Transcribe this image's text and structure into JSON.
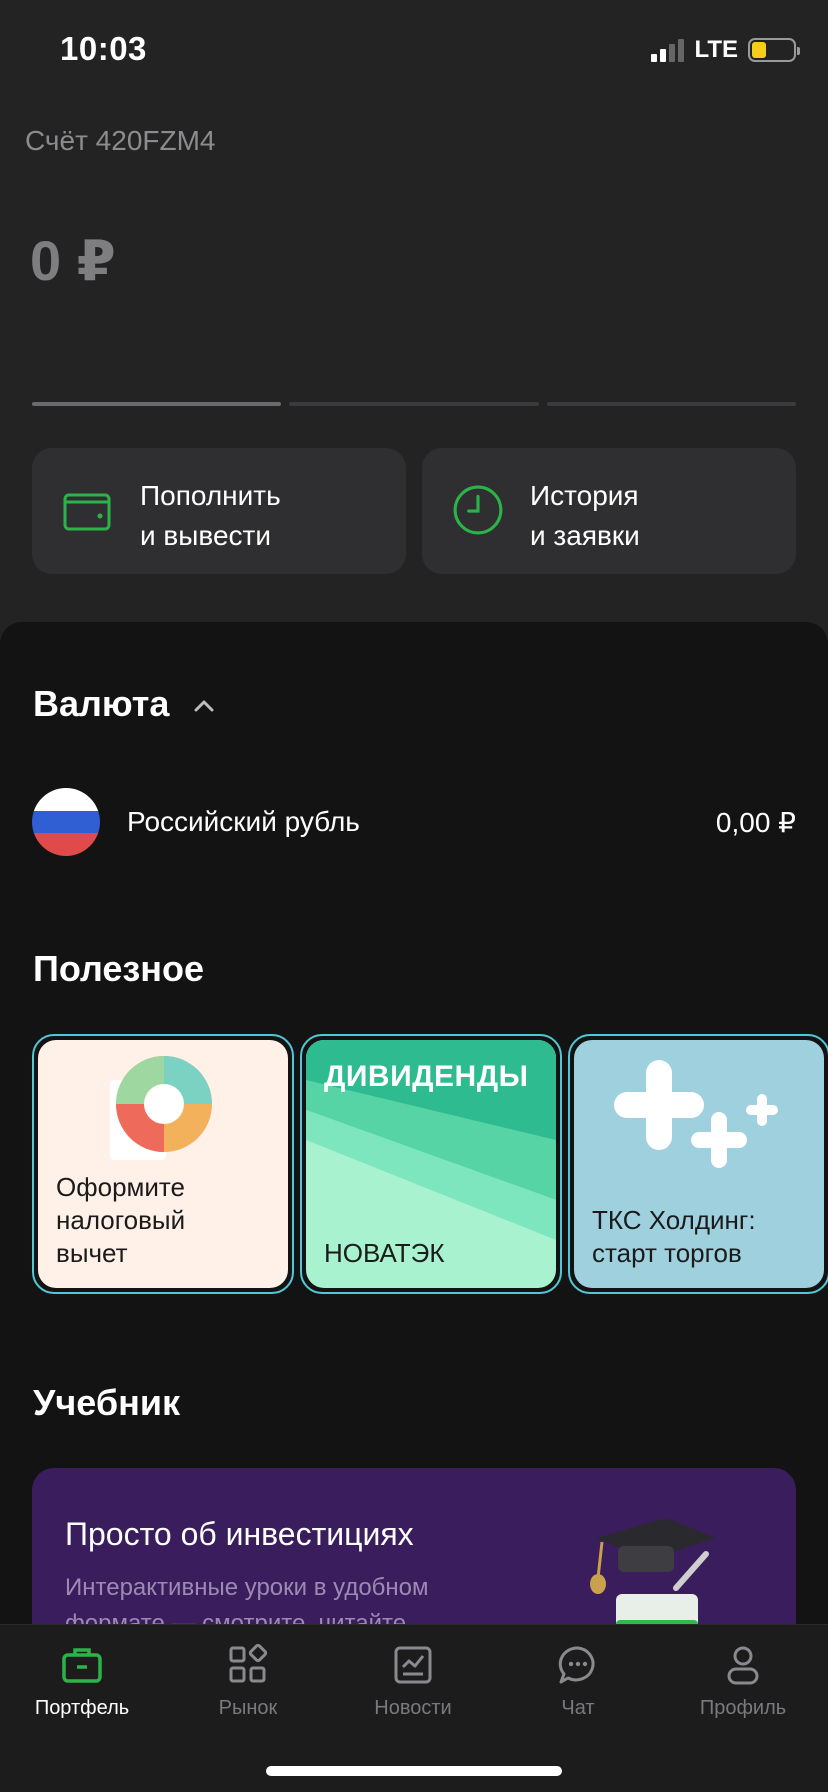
{
  "status": {
    "time": "10:03",
    "network": "LTE"
  },
  "account": {
    "label": "Счёт 420FZM4",
    "balance": "0 ₽"
  },
  "actions": [
    {
      "line1": "Пополнить",
      "line2": "и вывести",
      "icon": "wallet-icon"
    },
    {
      "line1": "История",
      "line2": "и заявки",
      "icon": "clock-icon"
    }
  ],
  "currency": {
    "title": "Валюта",
    "items": [
      {
        "name": "Российский рубль",
        "amount": "0,00 ₽",
        "icon": "russia-flag-icon"
      }
    ]
  },
  "useful": {
    "title": "Полезное",
    "cards": [
      {
        "text": [
          "Оформите",
          "налоговый",
          "вычет"
        ],
        "bg": "#fff0e8"
      },
      {
        "badge": "ДИВИДЕНДЫ",
        "text": [
          "НОВАТЭК"
        ],
        "bg": "#a8f2d0"
      },
      {
        "text": [
          "ТКС Холдинг:",
          "старт торгов"
        ],
        "bg": "#9ed0de"
      }
    ]
  },
  "tutorial": {
    "title": "Учебник",
    "promo_title": "Просто об инвестициях",
    "promo_sub": "Интерактивные уроки в удобном формате — смотрите, читайте"
  },
  "tabbar": {
    "items": [
      {
        "label": "Портфель",
        "icon": "briefcase-icon",
        "active": true
      },
      {
        "label": "Рынок",
        "icon": "market-grid-icon"
      },
      {
        "label": "Новости",
        "icon": "news-icon"
      },
      {
        "label": "Чат",
        "icon": "chat-icon"
      },
      {
        "label": "Профиль",
        "icon": "profile-icon"
      }
    ]
  },
  "colors": {
    "accent": "#2bb34a",
    "background": "#131314",
    "header": "#232324"
  }
}
